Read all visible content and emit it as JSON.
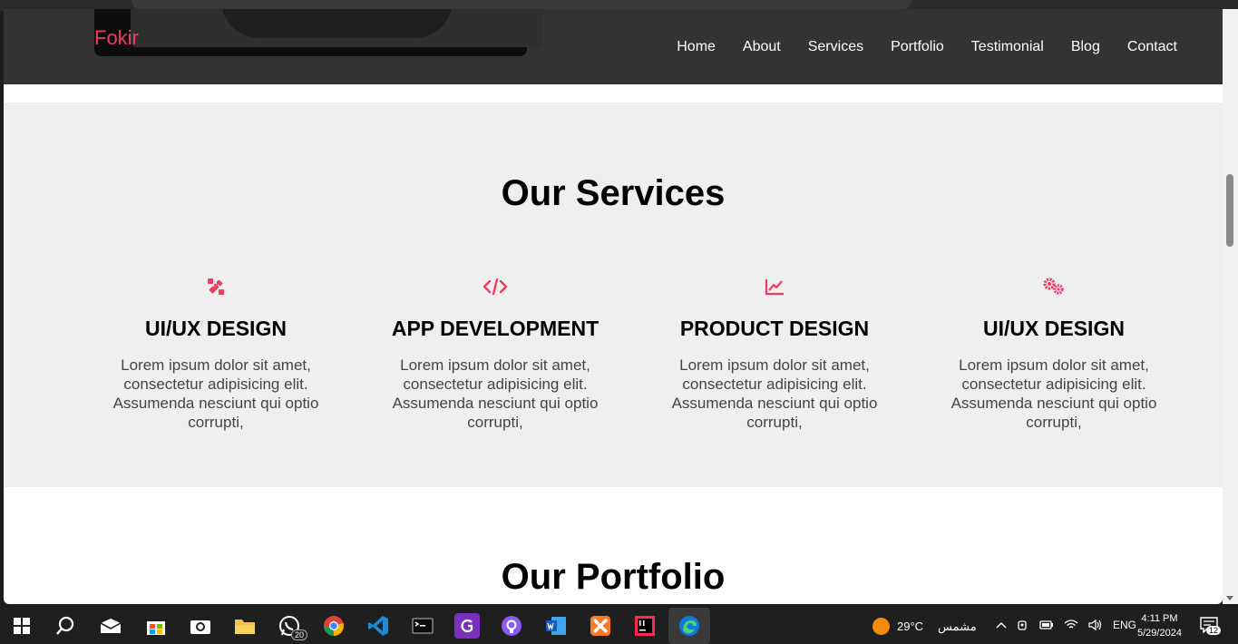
{
  "site": {
    "brand": "Fokir",
    "nav": [
      "Home",
      "About",
      "Services",
      "Portfolio",
      "Testimonial",
      "Blog",
      "Contact"
    ]
  },
  "services": {
    "title": "Our Services",
    "cards": [
      {
        "icon": "pen-ruler-icon",
        "title": "UI/UX DESIGN",
        "text": "Lorem ipsum dolor sit amet, consectetur adipisicing elit. Assumenda nesciunt qui optio corrupti,"
      },
      {
        "icon": "code-icon",
        "title": "APP DEVELOPMENT",
        "text": "Lorem ipsum dolor sit amet, consectetur adipisicing elit. Assumenda nesciunt qui optio corrupti,"
      },
      {
        "icon": "chart-line-icon",
        "title": "PRODUCT DESIGN",
        "text": "Lorem ipsum dolor sit amet, consectetur adipisicing elit. Assumenda nesciunt qui optio corrupti,"
      },
      {
        "icon": "gears-icon",
        "title": "UI/UX DESIGN",
        "text": "Lorem ipsum dolor sit amet, consectetur adipisicing elit. Assumenda nesciunt qui optio corrupti,"
      }
    ]
  },
  "portfolio": {
    "title": "Our Portfolio"
  },
  "colors": {
    "accent": "#f23c5f",
    "navbar": "#333333",
    "section_bg": "#f0efef"
  },
  "taskbar": {
    "apps": [
      "start-icon",
      "search-icon",
      "mail-icon",
      "store-icon",
      "camera-icon",
      "file-explorer-icon",
      "whatsapp-icon",
      "chrome-icon",
      "vscode-icon",
      "terminal-icon",
      "pdf-app-icon",
      "github-icon",
      "word-icon",
      "xampp-icon",
      "intellij-icon",
      "edge-icon"
    ],
    "whatsapp_badge": "20",
    "weather_temp": "29°C",
    "weather_desc": "مشمس",
    "language": "ENG",
    "time": "4:11 PM",
    "date": "5/29/2024",
    "notification_count": "12"
  }
}
